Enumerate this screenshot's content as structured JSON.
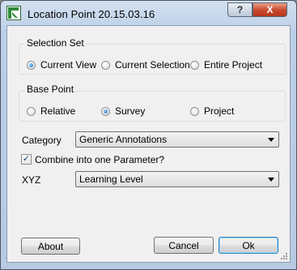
{
  "window": {
    "title": "Location Point 20.15.03.16",
    "help_glyph": "?",
    "close_glyph": "X"
  },
  "selection_set": {
    "label": "Selection Set",
    "options": [
      "Current View",
      "Current Selection",
      "Entire Project"
    ],
    "selected": "Current View"
  },
  "base_point": {
    "label": "Base Point",
    "options": [
      "Relative",
      "Survey",
      "Project"
    ],
    "selected": "Survey"
  },
  "category": {
    "label": "Category",
    "value": "Generic Annotations"
  },
  "combine": {
    "label": "Combine into one Parameter?",
    "checked": true,
    "check_glyph": "✓"
  },
  "xyz": {
    "label": "XYZ",
    "value": "Learning Level"
  },
  "buttons": {
    "about": "About",
    "cancel": "Cancel",
    "ok": "Ok"
  },
  "colors": {
    "title_bar": "#bccfe8",
    "close_button": "#c8472b",
    "client_bg": "#f0f0f0",
    "radio_dot": "#1a62b8"
  }
}
